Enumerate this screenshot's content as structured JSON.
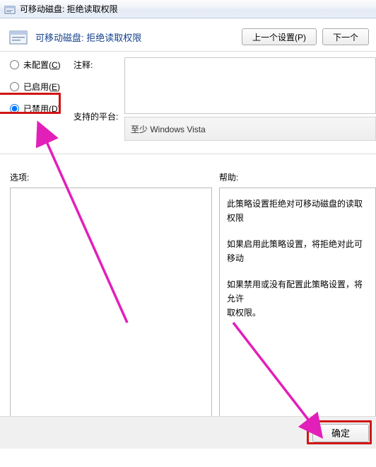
{
  "window": {
    "title": "可移动磁盘: 拒绝读取权限"
  },
  "header": {
    "title": "可移动磁盘: 拒绝读取权限",
    "prev_button": "上一个设置(P)",
    "next_button": "下一个"
  },
  "radios": {
    "not_configured": "未配置(C)",
    "enabled": "已启用(E)",
    "disabled": "已禁用(D)",
    "selected": "disabled"
  },
  "labels": {
    "comment": "注释:",
    "platform": "支持的平台:",
    "options": "选项:",
    "help": "帮助:"
  },
  "fields": {
    "comment_value": "",
    "platform_value": "至少 Windows Vista"
  },
  "help": {
    "p1": "此策略设置拒绝对可移动磁盘的读取权限",
    "p2": "如果启用此策略设置，将拒绝对此可移动",
    "p3": "如果禁用或没有配置此策略设置，将允许",
    "p4": "取权限。"
  },
  "buttons": {
    "ok": "确定"
  },
  "annotation": {
    "color": "#e21fb9"
  }
}
